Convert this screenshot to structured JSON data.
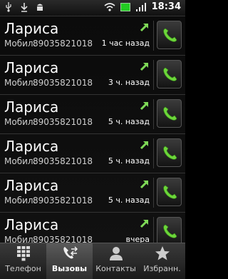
{
  "status": {
    "left_icons": [
      "usb-icon",
      "download-icon",
      "android-debug-icon"
    ],
    "right_icons": [
      "wifi-icon",
      "battery-icon",
      "signal-icon"
    ],
    "time": "18:34"
  },
  "calls": [
    {
      "name": "Лариса",
      "type": "Мобил.",
      "number": "89035821018",
      "time": "1 час назад"
    },
    {
      "name": "Лариса",
      "type": "Мобил.",
      "number": "89035821018",
      "time": "3 ч. назад"
    },
    {
      "name": "Лариса",
      "type": "Мобил.",
      "number": "89035821018",
      "time": "5 ч. назад"
    },
    {
      "name": "Лариса",
      "type": "Мобил.",
      "number": "89035821018",
      "time": "5 ч. назад"
    },
    {
      "name": "Лариса",
      "type": "Мобил.",
      "number": "89035821018",
      "time": "5 ч. назад"
    },
    {
      "name": "Лариса",
      "type": "Мобил.",
      "number": "89035821018",
      "time": "вчера"
    }
  ],
  "tabs": [
    {
      "label": "Телефон",
      "icon": "dialpad-icon"
    },
    {
      "label": "Вызовы",
      "icon": "calls-icon",
      "active": true
    },
    {
      "label": "Контакты",
      "icon": "contact-icon"
    },
    {
      "label": "Избранн.",
      "icon": "star-icon"
    }
  ],
  "colors": {
    "accent_green": "#6cd63a",
    "arrow_green": "#7ed957",
    "bg": "#000000"
  }
}
